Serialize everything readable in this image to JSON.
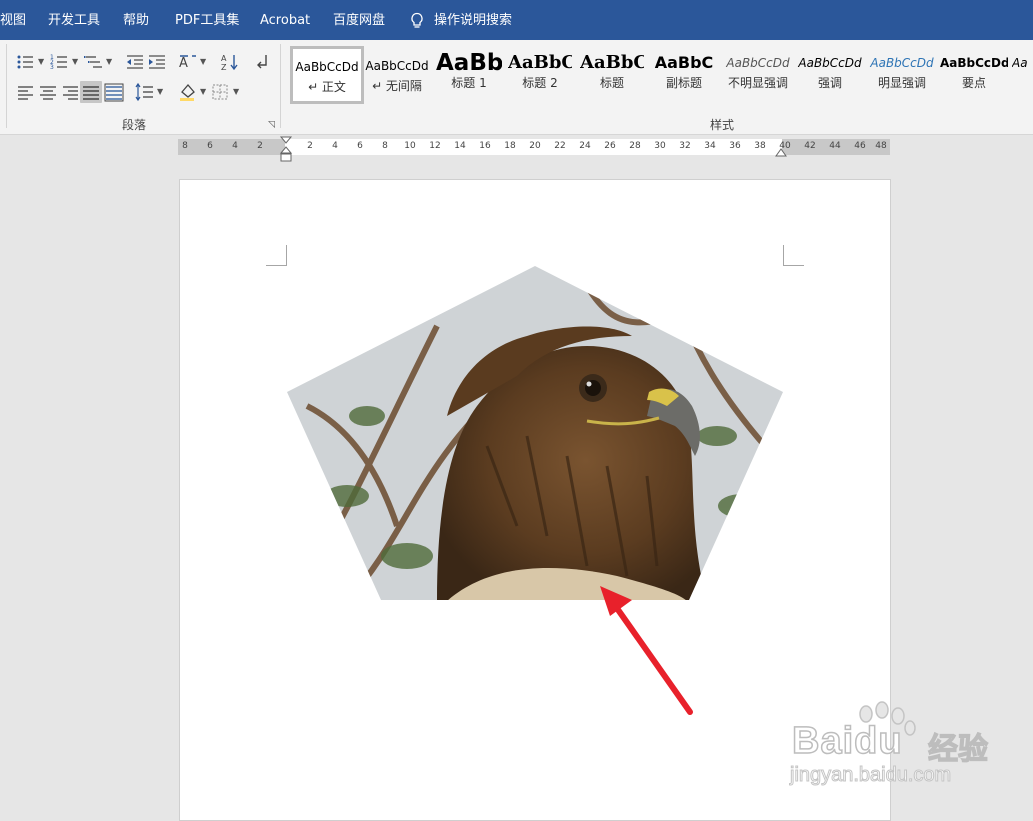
{
  "menu": {
    "items": [
      "视图",
      "开发工具",
      "帮助",
      "PDF工具集",
      "Acrobat",
      "百度网盘"
    ],
    "tell_me": "操作说明搜索"
  },
  "ribbon": {
    "paragraph_group_label": "段落",
    "styles_group_label": "样式",
    "styles": [
      {
        "preview": "AaBbCcDd",
        "name": "↵ 正文"
      },
      {
        "preview": "AaBbCcDd",
        "name": "↵ 无间隔"
      },
      {
        "preview": "AaBb",
        "name": "标题 1"
      },
      {
        "preview": "AaBbC",
        "name": "标题 2"
      },
      {
        "preview": "AaBbC",
        "name": "标题"
      },
      {
        "preview": "AaBbC",
        "name": "副标题"
      },
      {
        "preview": "AaBbCcDd",
        "name": "不明显强调"
      },
      {
        "preview": "AaBbCcDd",
        "name": "强调"
      },
      {
        "preview": "AaBbCcDd",
        "name": "明显强调"
      },
      {
        "preview": "AaBbCcDd",
        "name": "要点"
      },
      {
        "preview": "Aa",
        "name": ""
      }
    ]
  },
  "ruler": {
    "left_ticks": [
      "8",
      "6",
      "4",
      "2"
    ],
    "right_ticks": [
      "2",
      "4",
      "6",
      "8",
      "10",
      "12",
      "14",
      "16",
      "18",
      "20",
      "22",
      "24",
      "26",
      "28",
      "30",
      "32",
      "34",
      "36",
      "38",
      "40",
      "42",
      "44",
      "46",
      "48"
    ]
  },
  "document": {
    "image_shape": "pentagon",
    "image_subject": "eagle",
    "annotation": "red-arrow"
  },
  "colors": {
    "titlebar": "#2b579a",
    "arrow": "#e8212b",
    "link_style": "#2e74b5"
  },
  "watermark": {
    "brand": "Baidu",
    "brand_cn": "经验",
    "url": "jingyan.baidu.com"
  }
}
